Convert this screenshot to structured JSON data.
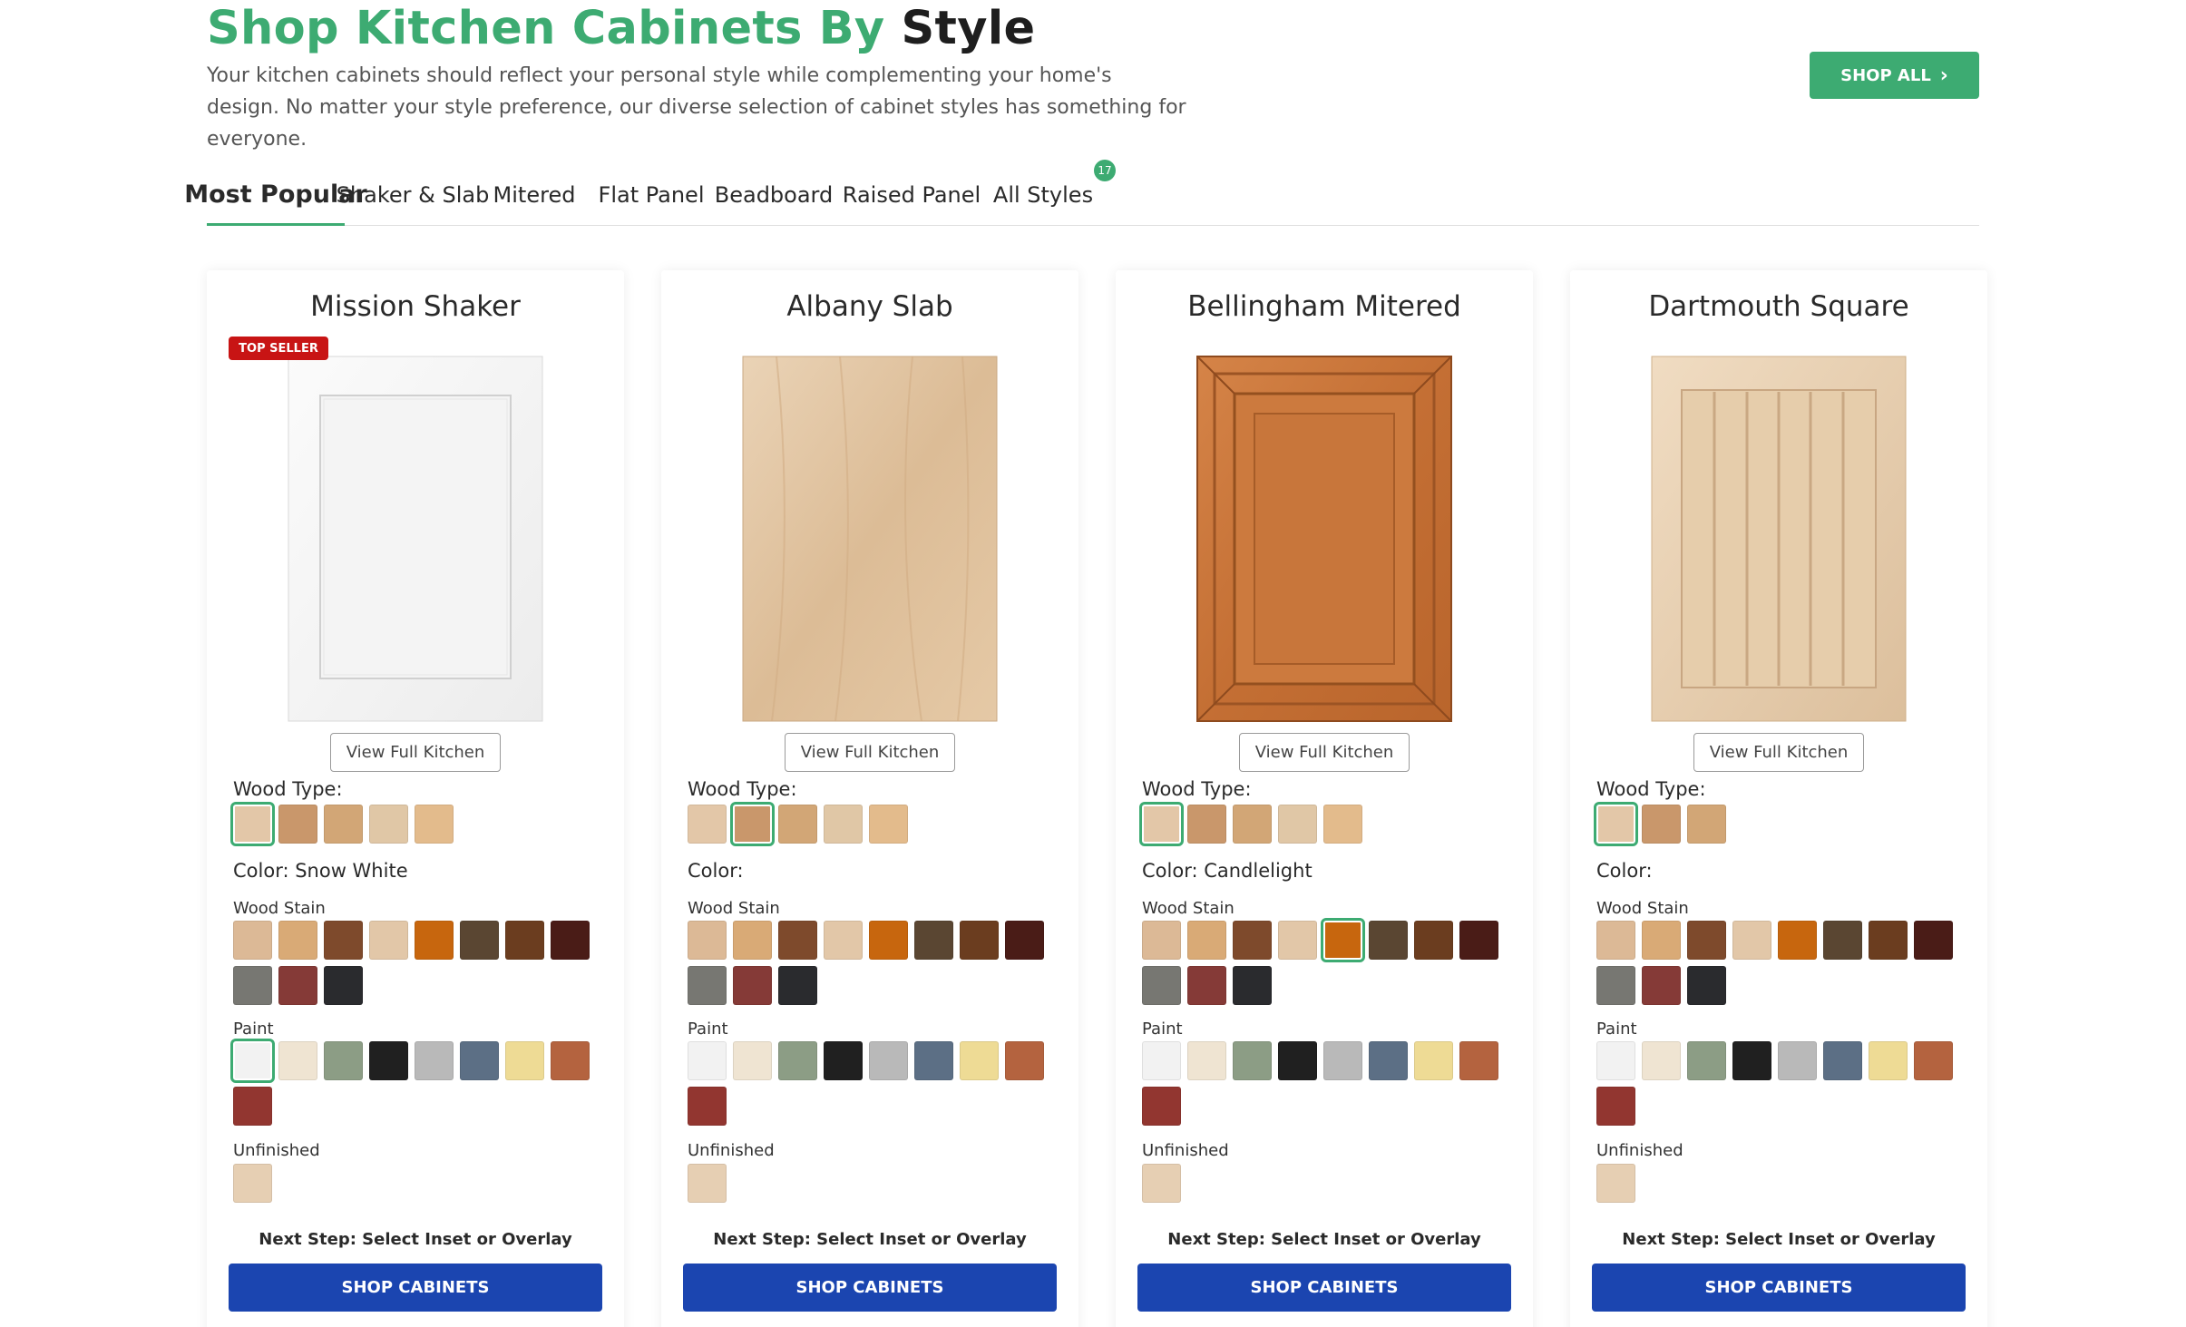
{
  "header": {
    "title_green": "Shop Kitchen Cabinets By",
    "title_dark": "Style",
    "intro": "Your kitchen cabinets should reflect your personal style while complementing your home's design. No matter your style preference, our diverse selection of cabinet styles has something for everyone.",
    "shop_all_label": "SHOP ALL",
    "shop_all_icon": "chevron-right-icon"
  },
  "tabs": [
    {
      "label": "Most Popular",
      "active": true
    },
    {
      "label": "Shaker & Slab"
    },
    {
      "label": "Mitered"
    },
    {
      "label": "Flat Panel"
    },
    {
      "label": "Beadboard"
    },
    {
      "label": "Raised Panel"
    },
    {
      "label": "All Styles",
      "badge": "17"
    }
  ],
  "labels": {
    "wood_type": "Wood Type:",
    "wood_stain": "Wood Stain",
    "paint": "Paint",
    "unfinished": "Unfinished",
    "view_full_kitchen": "View Full Kitchen",
    "next_step": "Next Step: Select Inset or Overlay",
    "shop_cabinets": "SHOP CABINETS",
    "top_seller": "TOP SELLER"
  },
  "colors": {
    "brand_green": "#3dab72",
    "brand_blue": "#1b45b0",
    "top_seller_red": "#c81414"
  },
  "swatch_palettes": {
    "wood": [
      "#e3c7a8",
      "#c9976b",
      "#d2a676",
      "#e0c7a6",
      "#e3bb8c"
    ],
    "stain": [
      "#dcb996",
      "#d9aa76",
      "#7e4a2c",
      "#e2c7a8",
      "#c7660e",
      "#5a4632",
      "#6b3d1f",
      "#4a1c17",
      "#777772",
      "#853a37",
      "#2a2b2e"
    ],
    "paint": [
      "#f2f2f2",
      "#efe4d2",
      "#8c9d85",
      "#202020",
      "#b9b9b9",
      "#5c6f85",
      "#eedb95",
      "#b4633f",
      "#923630"
    ],
    "unfinished": [
      "#e6cfb3"
    ]
  },
  "cards": [
    {
      "name": "Mission Shaker",
      "top_seller": true,
      "color_text": "Color: Snow White",
      "wood_count": 5,
      "sel_group": "paint",
      "sel_index": 0,
      "wood_sel": 0,
      "door": "shaker-white"
    },
    {
      "name": "Albany Slab",
      "top_seller": false,
      "color_text": "Color:",
      "wood_count": 5,
      "sel_group": null,
      "sel_index": null,
      "wood_sel": 1,
      "door": "slab-maple"
    },
    {
      "name": "Bellingham Mitered",
      "top_seller": false,
      "color_text": "Color: Candlelight",
      "wood_count": 5,
      "sel_group": "stain",
      "sel_index": 4,
      "wood_sel": 0,
      "door": "mitered-candlelight"
    },
    {
      "name": "Dartmouth Square",
      "top_seller": false,
      "color_text": "Color:",
      "wood_count": 3,
      "sel_group": null,
      "sel_index": null,
      "wood_sel": 0,
      "door": "beadboard-maple"
    }
  ]
}
